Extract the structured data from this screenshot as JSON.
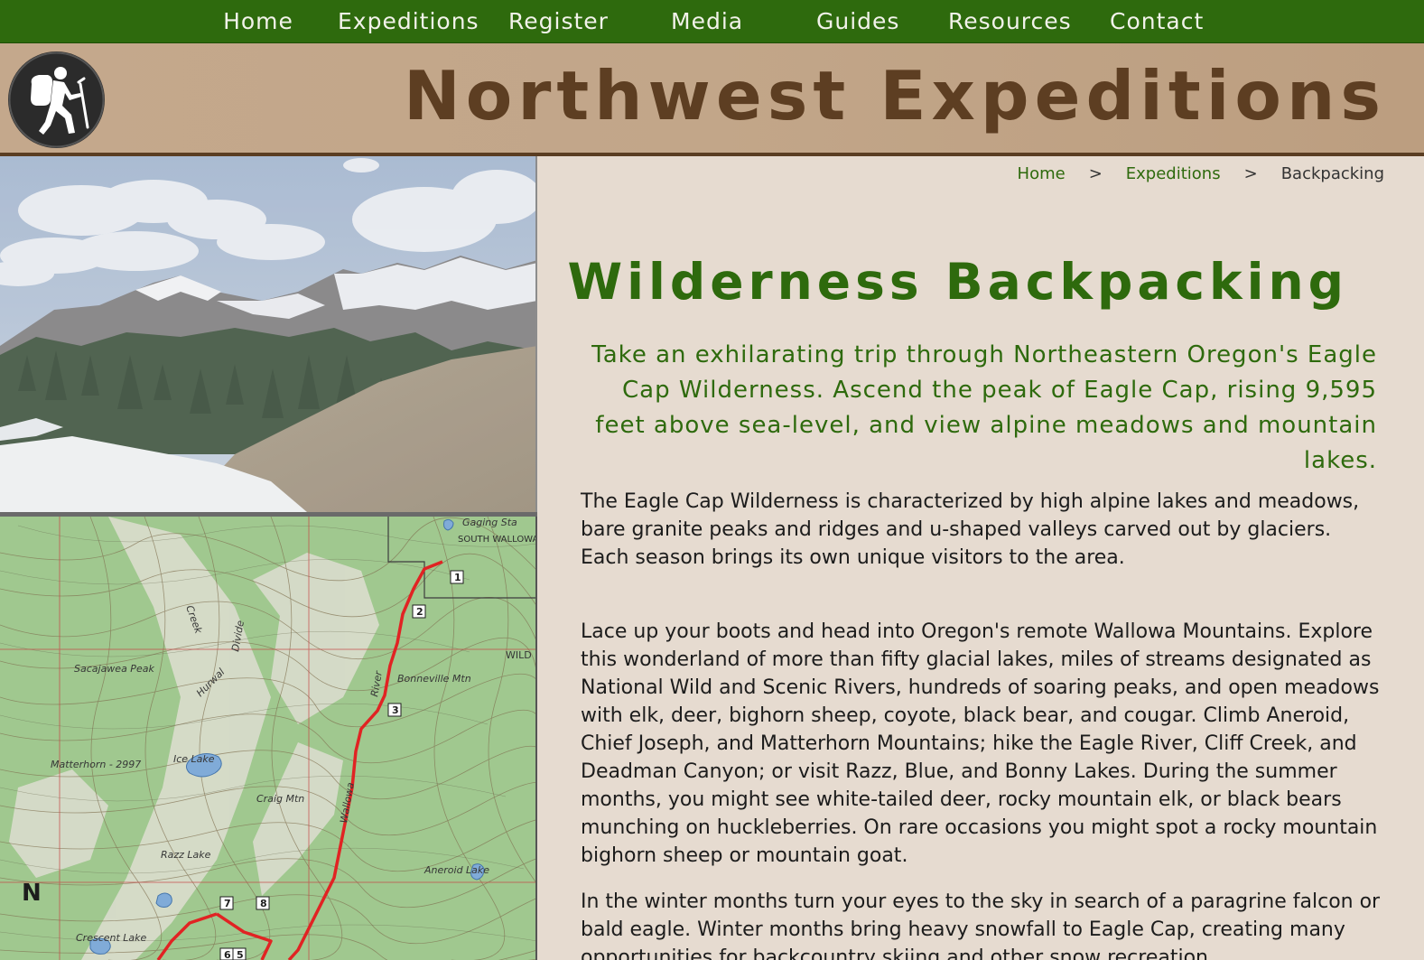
{
  "nav": {
    "items": [
      {
        "label": "Home"
      },
      {
        "label": "Expeditions"
      },
      {
        "label": "Register"
      },
      {
        "label": "Media"
      },
      {
        "label": "Guides"
      },
      {
        "label": "Resources"
      },
      {
        "label": "Contact"
      }
    ]
  },
  "header": {
    "title": "Northwest Expeditions",
    "logo_icon": "hiker-icon"
  },
  "breadcrumb": {
    "home": "Home",
    "sep1": ">",
    "expeditions": "Expeditions",
    "sep2": ">",
    "current": "Backpacking"
  },
  "main": {
    "heading": "Wilderness Backpacking",
    "lead": "Take an exhilarating trip through Northeastern Oregon's Eagle Cap Wilderness. Ascend the peak of Eagle Cap, rising 9,595 feet above sea-level, and view alpine meadows and mountain lakes.",
    "paragraphs": [
      "The Eagle Cap Wilderness is characterized by high alpine lakes and meadows, bare granite peaks and ridges and u-shaped valleys carved out by glaciers. Each season brings its own unique visitors to the area.",
      "Lace up your boots and head into Oregon's remote Wallowa Mountains. Explore this wonderland of more than fifty glacial lakes, miles of streams designated as National Wild and Scenic Rivers, hundreds of soaring peaks, and open meadows with elk, deer, bighorn sheep, coyote, black bear, and cougar. Climb Aneroid, Chief Joseph, and Matterhorn Mountains; hike the Eagle River, Cliff Creek, and Deadman Canyon; or visit Razz, Blue, and Bonny Lakes. During the summer months, you might see white-tailed deer, rocky mountain elk, or black bears munching on huckleberries. On rare occasions you might spot a rocky mountain bighorn sheep or mountain goat.",
      "In the winter months turn your eyes to the sky in search of a paragrine falcon or bald eagle. Winter months bring heavy snowfall to Eagle Cap, creating many opportunities for backcountry skiing and other snow recreation."
    ]
  },
  "map": {
    "labels": {
      "sacajawea": "Sacajawea Peak",
      "matterhorn": "Matterhorn - 2997",
      "bonneville": "Bonneville Mtn",
      "craig": "Craig Mtn",
      "ice_lake": "Ice Lake",
      "razz_lake": "Razz Lake",
      "crescent_lake": "Crescent Lake",
      "gaging": "Gaging Sta",
      "state_park": "SOUTH WALLOWA STATE PARK",
      "hurwal": "Hurwal",
      "divide": "Divide",
      "creek": "Creek",
      "river": "River",
      "wallowa": "Wallowa",
      "aneroid": "Aneroid Lake",
      "wild": "WILD",
      "north": "N",
      "markers": [
        "1",
        "2",
        "3",
        "7",
        "8",
        "6",
        "5"
      ]
    }
  },
  "colors": {
    "nav_bg": "#2e6a0d",
    "header_bg": "#c4a88c",
    "title_brown": "#5d3e22",
    "accent_green": "#2e6a0d",
    "page_bg": "#e6dbd0"
  }
}
